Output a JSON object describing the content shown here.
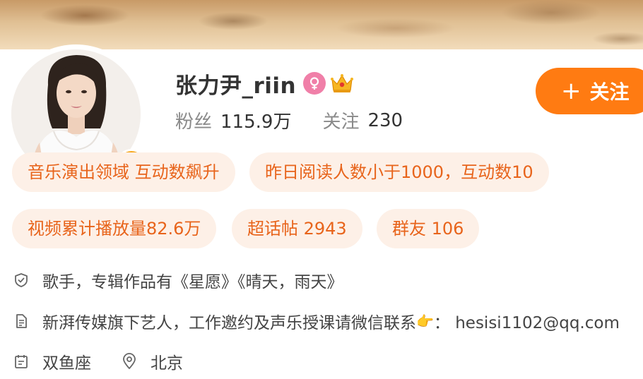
{
  "profile": {
    "name": "张力尹_riin",
    "verified_badge": "V",
    "gender_icon": "female-icon",
    "vip_icon": "crown-icon",
    "stats": {
      "fans_label": "粉丝",
      "fans_value": "115.9万",
      "following_label": "关注",
      "following_value": "230"
    },
    "follow_button": {
      "icon": "+",
      "label": "关注"
    }
  },
  "tags": [
    "音乐演出领域 互动数飙升",
    "昨日阅读人数小于1000，互动数10",
    "视频累计播放量82.6万",
    "超话帖 2943",
    "群友 106"
  ],
  "info": {
    "bio": "歌手，专辑作品有《星愿》《晴天，雨天》",
    "contact_text": "新湃传媒旗下艺人，工作邀约及声乐授课请微信联系",
    "contact_emoji": "👉",
    "contact_suffix": "： hesisi1102@qq.com",
    "zodiac": "双鱼座",
    "location": "北京"
  },
  "colors": {
    "accent": "#ff7b12",
    "tag_bg": "#fdf0e7",
    "tag_text": "#e8641b",
    "verified": "#f7a81b",
    "female": "#f07fa8"
  }
}
